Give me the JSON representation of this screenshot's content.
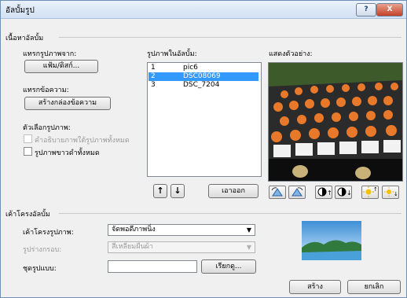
{
  "window": {
    "title": "อัลบั้มรูป",
    "help_label": "?",
    "close_label": "X"
  },
  "album_content": {
    "section_title": "เนื้อหาอัลบั้ม",
    "insert_from_label": "แทรกรูปภาพจาก:",
    "file_disk_button": "แฟ้ม/ดิสก์...",
    "insert_text_label": "แทรกข้อความ:",
    "new_textbox_button": "สร้างกล่องข้อความ",
    "picture_options_label": "ตัวเลือกรูปภาพ:",
    "captions_option": "คำอธิบายภาพใต้รูปภาพทั้งหมด",
    "captions_checked": false,
    "bw_option": "รูปภาพขาวดำทั้งหมด",
    "bw_checked": false
  },
  "pictures_list": {
    "label": "รูปภาพในอัลบั้ม:",
    "items": [
      {
        "index": "1",
        "name": "pic6",
        "selected": false
      },
      {
        "index": "2",
        "name": "DSC08069",
        "selected": true
      },
      {
        "index": "3",
        "name": "DSC_7204",
        "selected": false
      }
    ],
    "move_up_icon": "↑",
    "move_down_icon": "↓",
    "remove_button": "เอาออก"
  },
  "preview": {
    "label": "แสดงตัวอย่าง:"
  },
  "album_layout": {
    "section_title": "เค้าโครงอัลบั้ม",
    "picture_layout_label": "เค้าโครงรูปภาพ:",
    "picture_layout_value": "จัดพอดีภาพนิ่ง",
    "frame_shape_label": "รูปร่างกรอบ:",
    "frame_shape_value": "สี่เหลี่ยมผืนผ้า",
    "theme_label": "ชุดรูปแบบ:",
    "theme_value": "",
    "browse_button": "เรียกดู..."
  },
  "footer": {
    "create_button": "สร้าง",
    "cancel_button": "ยกเลิก"
  },
  "colors": {
    "selection": "#3399ff",
    "title_gradient_top": "#e9f1fb",
    "close_red": "#c4412a"
  }
}
